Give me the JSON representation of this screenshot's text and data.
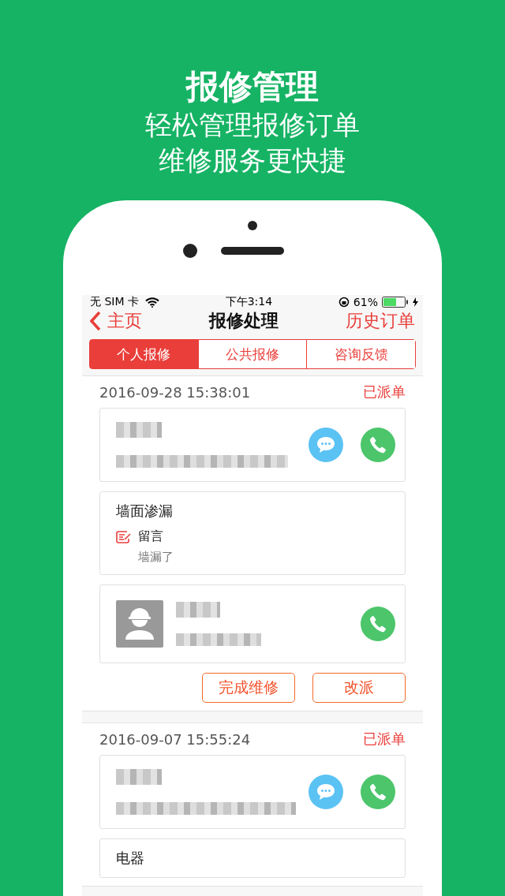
{
  "promo": {
    "headline": "报修管理",
    "taglines": [
      "轻松管理报修订单",
      "维修服务更快捷"
    ]
  },
  "status_bar": {
    "carrier": "无 SIM 卡",
    "time": "下午3:14",
    "battery": "61%"
  },
  "nav": {
    "back": "主页",
    "title": "报修处理",
    "action": "历史订单"
  },
  "tabs": [
    {
      "label": "个人报修",
      "selected": true
    },
    {
      "label": "公共报修",
      "selected": false
    },
    {
      "label": "咨询反馈",
      "selected": false
    }
  ],
  "orders": [
    {
      "time": "2016-09-28 15:38:01",
      "status": "已派单",
      "panels": [
        {
          "kind": "customer"
        },
        {
          "kind": "issue",
          "title": "墙面渗漏",
          "note_label": "留言",
          "note": "墙漏了"
        },
        {
          "kind": "worker"
        }
      ],
      "actions": [
        "完成维修",
        "改派"
      ]
    },
    {
      "time": "2016-09-07 15:55:24",
      "status": "已派单",
      "panels": [
        {
          "kind": "customer"
        },
        {
          "kind": "issue",
          "title": "电器"
        }
      ]
    }
  ]
}
